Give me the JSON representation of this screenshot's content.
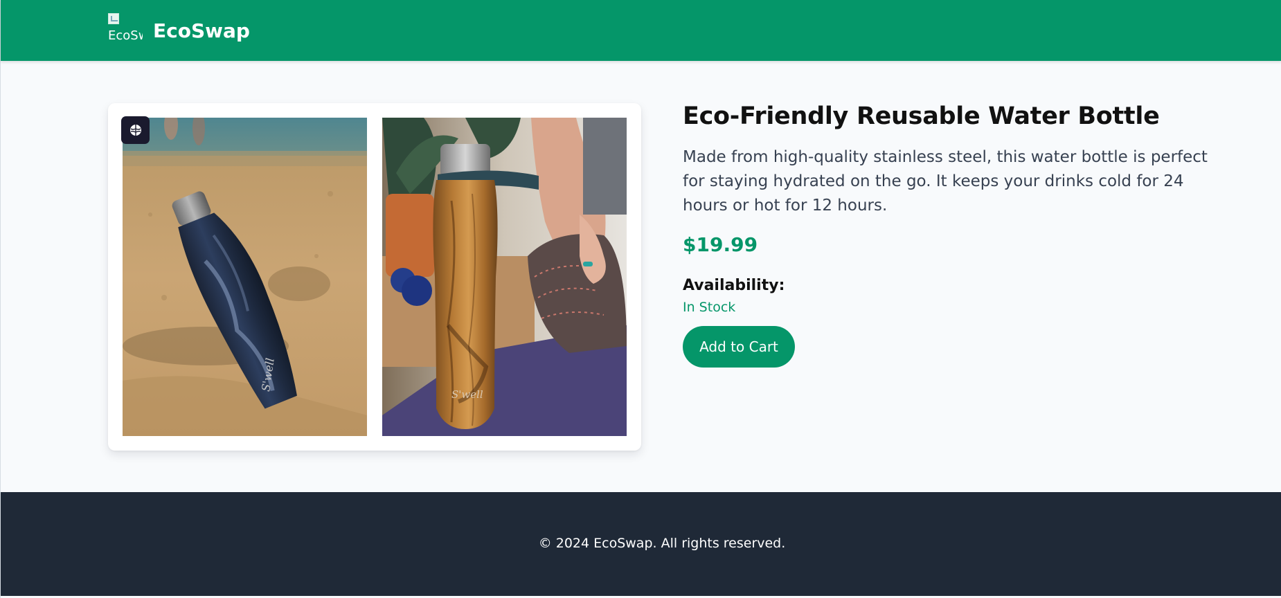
{
  "header": {
    "logo_alt": "EcoSwap",
    "brand": "EcoSwap",
    "color": "#059669"
  },
  "gallery": {
    "images": [
      {
        "icon": "water-bottle-on-sand-photo"
      },
      {
        "icon": "wood-grain-water-bottle-photo"
      }
    ],
    "badge_icon": "brain-icon"
  },
  "product": {
    "title": "Eco-Friendly Reusable Water Bottle",
    "description": "Made from high-quality stainless steel, this water bottle is perfect for staying hydrated on the go. It keeps your drinks cold for 24 hours or hot for 12 hours.",
    "price": "$19.99",
    "availability_label": "Availability:",
    "availability_value": "In Stock",
    "add_to_cart_label": "Add to Cart",
    "accent_color": "#059669"
  },
  "footer": {
    "copyright": "© 2024 EcoSwap. All rights reserved.",
    "background": "#1f2937"
  }
}
